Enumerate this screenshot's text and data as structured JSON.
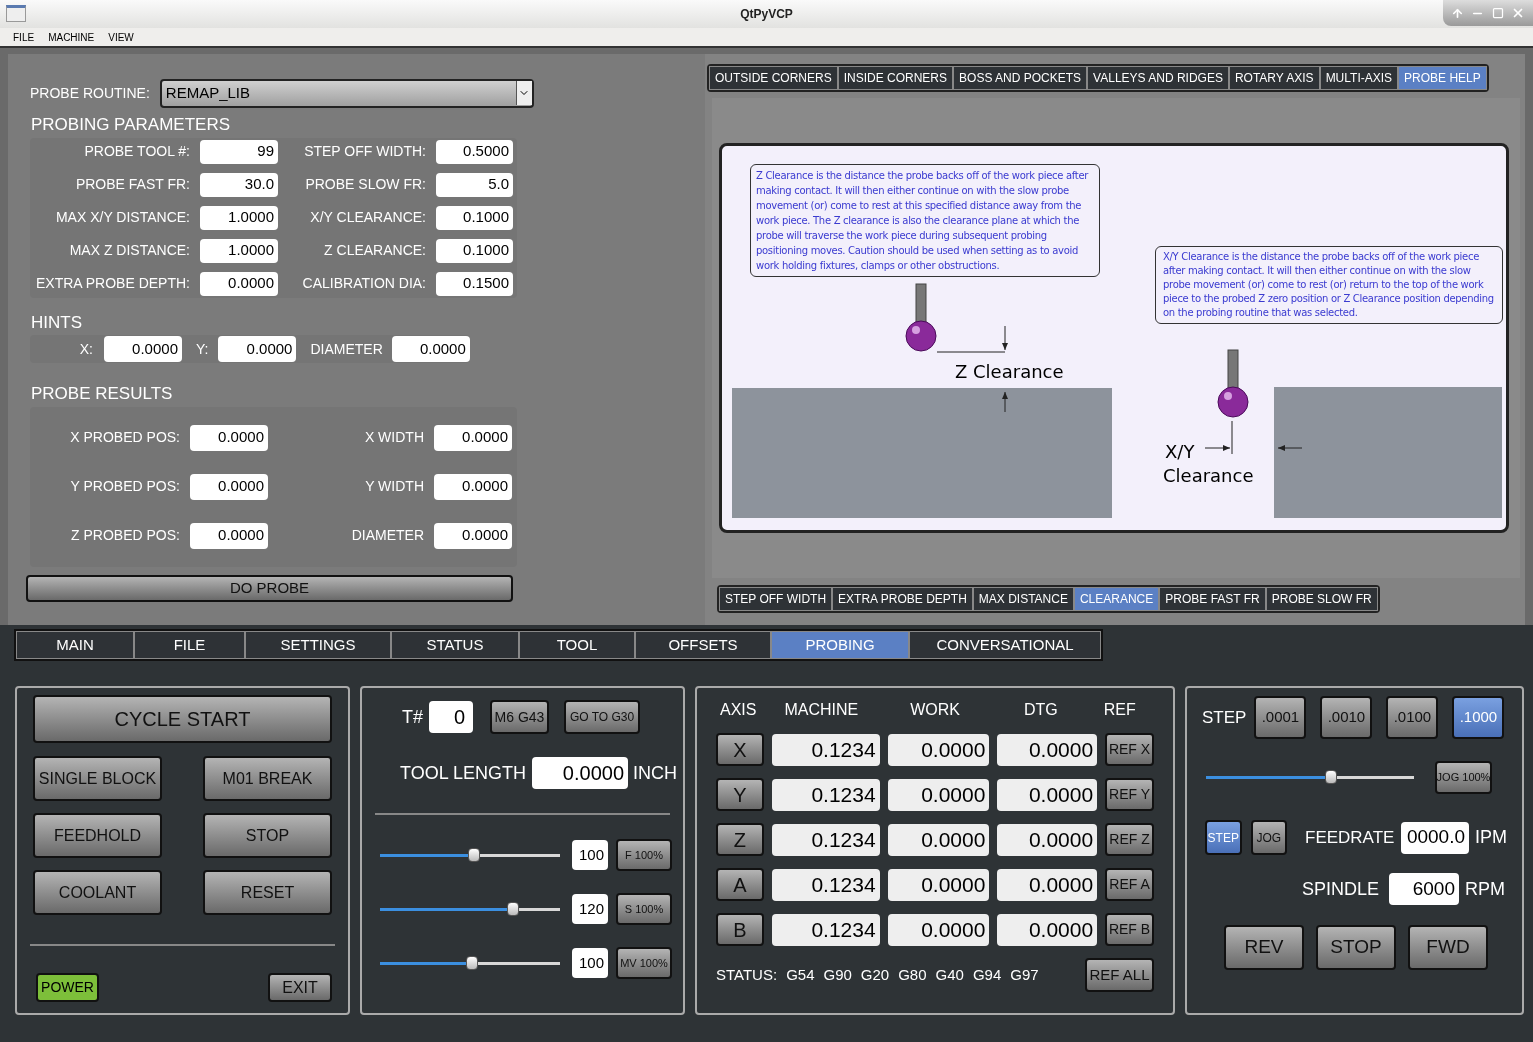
{
  "window": {
    "title": "QtPyVCP"
  },
  "menu": [
    "FILE",
    "MACHINE",
    "VIEW"
  ],
  "probe_routine": {
    "label": "PROBE ROUTINE:",
    "value": "REMAP_LIB"
  },
  "probing_parameters": {
    "title": "PROBING PARAMETERS",
    "fields": [
      {
        "label": "PROBE TOOL #:",
        "value": "99"
      },
      {
        "label": "STEP OFF WIDTH:",
        "value": "0.5000"
      },
      {
        "label": "PROBE FAST FR:",
        "value": "30.0"
      },
      {
        "label": "PROBE SLOW FR:",
        "value": "5.0"
      },
      {
        "label": "MAX X/Y DISTANCE:",
        "value": "1.0000"
      },
      {
        "label": "X/Y CLEARANCE:",
        "value": "0.1000"
      },
      {
        "label": "MAX Z DISTANCE:",
        "value": "1.0000"
      },
      {
        "label": "Z CLEARANCE:",
        "value": "0.1000"
      },
      {
        "label": "EXTRA PROBE DEPTH:",
        "value": "0.0000"
      },
      {
        "label": "CALIBRATION DIA:",
        "value": "0.1500"
      }
    ]
  },
  "hints": {
    "title": "HINTS",
    "fields": [
      {
        "label": "X:",
        "value": "0.0000"
      },
      {
        "label": "Y:",
        "value": "0.0000"
      },
      {
        "label": "DIAMETER",
        "value": "0.0000"
      }
    ]
  },
  "probe_results": {
    "title": "PROBE RESULTS",
    "fields": [
      {
        "label": "X PROBED POS:",
        "value": "0.0000"
      },
      {
        "label": "X WIDTH",
        "value": "0.0000"
      },
      {
        "label": "Y PROBED POS:",
        "value": "0.0000"
      },
      {
        "label": "Y WIDTH",
        "value": "0.0000"
      },
      {
        "label": "Z PROBED POS:",
        "value": "0.0000"
      },
      {
        "label": "DIAMETER",
        "value": "0.0000"
      }
    ]
  },
  "do_probe": "DO PROBE",
  "help_tabs": [
    {
      "label": "OUTSIDE CORNERS",
      "selected": false
    },
    {
      "label": "INSIDE CORNERS",
      "selected": false
    },
    {
      "label": "BOSS AND POCKETS",
      "selected": false
    },
    {
      "label": "VALLEYS AND RIDGES",
      "selected": false
    },
    {
      "label": "ROTARY AXIS",
      "selected": false
    },
    {
      "label": "MULTI-AXIS",
      "selected": false
    },
    {
      "label": "PROBE HELP",
      "selected": true
    }
  ],
  "help": {
    "z_note": "Z Clearance is the distance the probe backs off of the work piece after making contact.  It will then either continue on with the slow probe movement (or) come to rest at this specified distance away from the work piece.  The Z clearance is also the clearance plane at which the probe will traverse the work piece during subsequent probing positioning moves.  Caution should be used when setting as to avoid work holding fixtures, clamps or other obstructions.",
    "xy_note": "X/Y Clearance is the distance the probe backs off of the work piece after making contact.  It will then either continue on with the slow probe movement (or) come to rest (or) return to the top of the work piece to the probed Z zero position or Z Clearance position depending on the probing routine that was selected.",
    "z_label": "Z Clearance",
    "xy_label": [
      "X/Y",
      "Clearance"
    ]
  },
  "help_subtabs": [
    {
      "label": "STEP OFF WIDTH",
      "selected": false
    },
    {
      "label": "EXTRA PROBE DEPTH",
      "selected": false
    },
    {
      "label": "MAX DISTANCE",
      "selected": false
    },
    {
      "label": "CLEARANCE",
      "selected": true
    },
    {
      "label": "PROBE FAST FR",
      "selected": false
    },
    {
      "label": "PROBE SLOW FR",
      "selected": false
    }
  ],
  "main_tabs": [
    {
      "label": "MAIN",
      "selected": false
    },
    {
      "label": "FILE",
      "selected": false
    },
    {
      "label": "SETTINGS",
      "selected": false
    },
    {
      "label": "STATUS",
      "selected": false
    },
    {
      "label": "TOOL",
      "selected": false
    },
    {
      "label": "OFFSETS",
      "selected": false
    },
    {
      "label": "PROBING",
      "selected": true
    },
    {
      "label": "CONVERSATIONAL",
      "selected": false
    }
  ],
  "machine": {
    "cycle_start": "CYCLE START",
    "buttons": [
      "SINGLE BLOCK",
      "M01 BREAK",
      "FEEDHOLD",
      "STOP",
      "COOLANT",
      "RESET"
    ],
    "power": {
      "label": "POWER",
      "on": true
    },
    "exit": "EXIT"
  },
  "tool": {
    "t_label": "T#",
    "t_value": "0",
    "buttons": [
      "M6 G43",
      "GO TO G30"
    ],
    "length_label": "TOOL LENGTH",
    "length_value": "0.0000",
    "unit": "INCH"
  },
  "overrides": [
    {
      "level": 0.52,
      "value": "100",
      "button": "F 100%"
    },
    {
      "level": 0.74,
      "value": "120",
      "button": "S 100%"
    },
    {
      "level": 0.51,
      "value": "100",
      "button": "MV 100%"
    }
  ],
  "dro": {
    "columns": [
      "AXIS",
      "MACHINE",
      "WORK",
      "DTG",
      "REF"
    ],
    "rows": [
      {
        "axis": "X",
        "machine": "0.1234",
        "work": "0.0000",
        "dtg": "0.0000",
        "ref": "REF X"
      },
      {
        "axis": "Y",
        "machine": "0.1234",
        "work": "0.0000",
        "dtg": "0.0000",
        "ref": "REF Y"
      },
      {
        "axis": "Z",
        "machine": "0.1234",
        "work": "0.0000",
        "dtg": "0.0000",
        "ref": "REF Z"
      },
      {
        "axis": "A",
        "machine": "0.1234",
        "work": "0.0000",
        "dtg": "0.0000",
        "ref": "REF A"
      },
      {
        "axis": "B",
        "machine": "0.1234",
        "work": "0.0000",
        "dtg": "0.0000",
        "ref": "REF B"
      }
    ],
    "status_label": "STATUS:",
    "codes": [
      "G54",
      "G90",
      "G20",
      "G80",
      "G40",
      "G94",
      "G97"
    ],
    "ref_all": "REF ALL"
  },
  "jog": {
    "step_label": "STEP",
    "steps": [
      {
        "label": ".0001",
        "selected": false
      },
      {
        "label": ".0010",
        "selected": false
      },
      {
        "label": ".0100",
        "selected": false
      },
      {
        "label": ".1000",
        "selected": true
      }
    ],
    "level": 0.6,
    "jog_button": "JOG 100%",
    "modes": [
      {
        "label": "STEP",
        "selected": true
      },
      {
        "label": "JOG",
        "selected": false
      }
    ],
    "feed_label": "FEEDRATE",
    "feed_value": "0000.0",
    "feed_unit": "IPM",
    "spindle_label": "SPINDLE",
    "spindle_value": "6000",
    "spindle_unit": "RPM",
    "spindle_buttons": [
      "REV",
      "STOP",
      "FWD"
    ]
  }
}
